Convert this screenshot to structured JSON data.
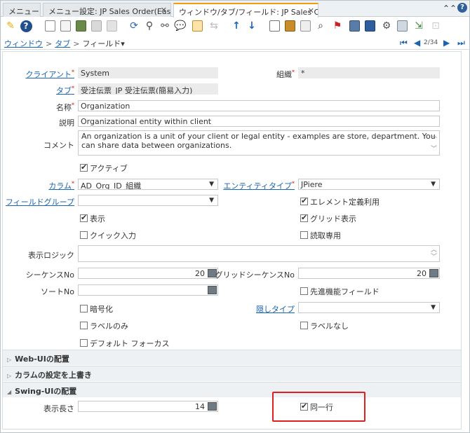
{
  "tabs": [
    {
      "label": "メニュー",
      "active": false
    },
    {
      "label": "メニュー設定: JP Sales Order(Easy...",
      "active": true,
      "closable": true
    },
    {
      "label": "ウィンドウ/タブ/フィールド: JP Sales Or...",
      "active": true,
      "closable": true
    }
  ],
  "tab_controls": {
    "collapse": "⌃⌃",
    "help": "?"
  },
  "breadcrumb": {
    "window": "ウィンドウ",
    "tab": "タブ",
    "current": "フィールド▾",
    "separator": ">"
  },
  "record_nav": {
    "position": "2/34"
  },
  "form": {
    "client_label": "クライアント",
    "client_value": "System",
    "org_label": "組織",
    "org_value": "*",
    "tab_label": "タブ",
    "tab_value": "受注伝票_JP 受注伝票(簡易入力)",
    "name_label": "名称",
    "name_value": "Organization",
    "desc_label": "説明",
    "desc_value": "Organizational entity within client",
    "comment_label": "コメント",
    "comment_value": "An organization is a unit of your client or legal entity - examples are store, department. You can share data between organizations.",
    "active_label": "アクティブ",
    "column_label": "カラム",
    "column_value": "AD_Org_ID_組織",
    "entity_label": "エンティティタイプ",
    "entity_value": "JPiere",
    "fieldgroup_label": "フィールドグループ",
    "fieldgroup_value": "",
    "centrally_label": "エレメント定義利用",
    "displayed_label": "表示",
    "grid_label": "グリッド表示",
    "quickentry_label": "クイック入力",
    "readonly_label": "読取専用",
    "displaylogic_label": "表示ロジック",
    "displaylogic_value": "",
    "seq_label": "シーケンスNo",
    "seq_value": "20",
    "gridseq_label": "グリッドシーケンスNo",
    "gridseq_value": "20",
    "sort_label": "ソートNo",
    "sort_value": "",
    "defaultfocus_field_label": "先進機能フィールド",
    "encrypted_label": "暗号化",
    "obscure_label": "隠しタイプ",
    "obscure_value": "",
    "labelonly_label": "ラベルのみ",
    "nolabel_label": "ラベルなし",
    "defaultfocus_label": "デフォルト フォーカス"
  },
  "sections": {
    "webui": "Web-UIの配置",
    "column_override": "カラムの設定を上書き",
    "swingui": "Swing-UIの配置"
  },
  "swing": {
    "displaylength_label": "表示長さ",
    "displaylength_value": "14",
    "sameline_label": "同一行"
  },
  "colors": {
    "accent": "#f29b0c",
    "link": "#1a64b0",
    "highlight": "#e02020"
  }
}
